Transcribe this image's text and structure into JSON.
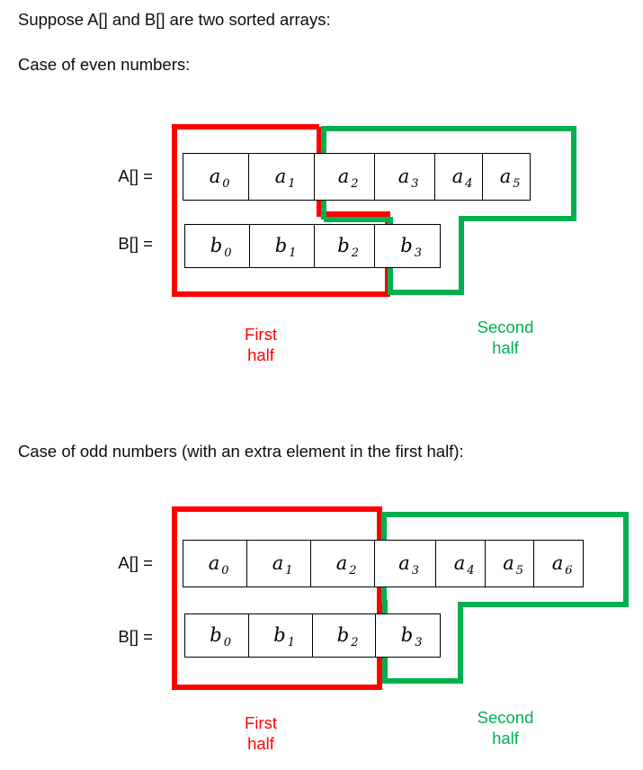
{
  "page": {
    "intro_line": "Suppose A[] and B[] are two sorted arrays:",
    "even_heading": "Case of even numbers:",
    "odd_heading": "Case of odd numbers (with an extra element in the first half):"
  },
  "colors": {
    "first_half": "#ff0000",
    "second_half": "#00b050",
    "cell_border": "#000000",
    "text": "#0d0d0d",
    "background": "#ffffff"
  },
  "captions": {
    "first_half_line1": "First",
    "first_half_line2": "half",
    "second_half_line1": "Second",
    "second_half_line2": "half"
  },
  "diagram_even": {
    "name": "Case of even numbers",
    "array_a": {
      "label": "A[] =",
      "cells": [
        {
          "base": "a",
          "sub": "0"
        },
        {
          "base": "a",
          "sub": "1"
        },
        {
          "base": "a",
          "sub": "2"
        },
        {
          "base": "a",
          "sub": "3"
        },
        {
          "base": "a",
          "sub": "4"
        },
        {
          "base": "a",
          "sub": "5"
        }
      ],
      "first_half_count": 2,
      "second_half_count": 4
    },
    "array_b": {
      "label": "B[] =",
      "cells": [
        {
          "base": "b",
          "sub": "0"
        },
        {
          "base": "b",
          "sub": "1"
        },
        {
          "base": "b",
          "sub": "2"
        },
        {
          "base": "b",
          "sub": "3"
        }
      ],
      "first_half_count": 3,
      "second_half_count": 1
    }
  },
  "diagram_odd": {
    "name": "Case of odd numbers",
    "array_a": {
      "label": "A[] =",
      "cells": [
        {
          "base": "a",
          "sub": "0"
        },
        {
          "base": "a",
          "sub": "1"
        },
        {
          "base": "a",
          "sub": "2"
        },
        {
          "base": "a",
          "sub": "3"
        },
        {
          "base": "a",
          "sub": "4"
        },
        {
          "base": "a",
          "sub": "5"
        },
        {
          "base": "a",
          "sub": "6"
        }
      ],
      "first_half_count": 3,
      "second_half_count": 4
    },
    "array_b": {
      "label": "B[] =",
      "cells": [
        {
          "base": "b",
          "sub": "0"
        },
        {
          "base": "b",
          "sub": "1"
        },
        {
          "base": "b",
          "sub": "2"
        },
        {
          "base": "b",
          "sub": "3"
        }
      ],
      "first_half_count": 3,
      "second_half_count": 1
    }
  }
}
